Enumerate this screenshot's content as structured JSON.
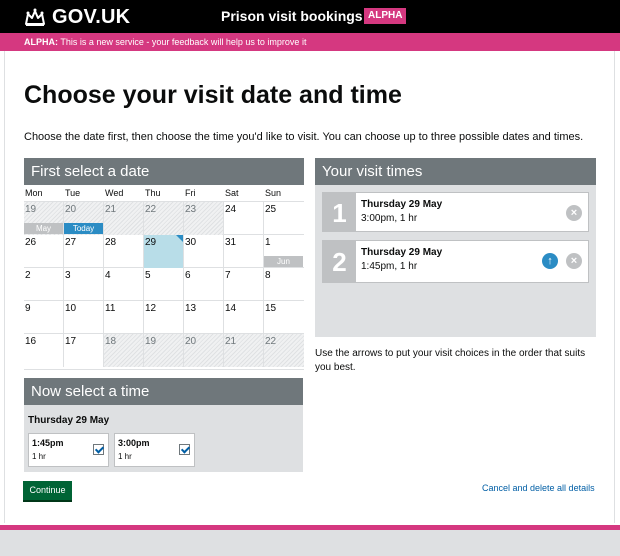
{
  "header": {
    "brand": "GOV.UK",
    "service_name": "Prison visit bookings",
    "phase_tag": "ALPHA"
  },
  "phase_banner": {
    "label": "ALPHA:",
    "text": "This is a new service - your feedback will help us to improve it"
  },
  "page": {
    "title": "Choose your visit date and time",
    "intro": "Choose the date first, then choose the time you'd like to visit. You can choose up to three possible dates and times."
  },
  "calendar": {
    "heading": "First select a date",
    "weekdays": [
      "Mon",
      "Tue",
      "Wed",
      "Thu",
      "Fri",
      "Sat",
      "Sun"
    ],
    "weeks": [
      [
        {
          "day": "19",
          "state": "past",
          "badge": "May",
          "badge_type": "month"
        },
        {
          "day": "20",
          "state": "past",
          "badge": "Today",
          "badge_type": "today"
        },
        {
          "day": "21",
          "state": "past"
        },
        {
          "day": "22",
          "state": "past"
        },
        {
          "day": "23",
          "state": "past"
        },
        {
          "day": "24",
          "state": "available"
        },
        {
          "day": "25",
          "state": "available"
        }
      ],
      [
        {
          "day": "26",
          "state": "available"
        },
        {
          "day": "27",
          "state": "available"
        },
        {
          "day": "28",
          "state": "available"
        },
        {
          "day": "29",
          "state": "selected"
        },
        {
          "day": "30",
          "state": "available"
        },
        {
          "day": "31",
          "state": "available"
        },
        {
          "day": "1",
          "state": "available",
          "badge": "Jun",
          "badge_type": "month"
        }
      ],
      [
        {
          "day": "2",
          "state": "available"
        },
        {
          "day": "3",
          "state": "available"
        },
        {
          "day": "4",
          "state": "available"
        },
        {
          "day": "5",
          "state": "available"
        },
        {
          "day": "6",
          "state": "available"
        },
        {
          "day": "7",
          "state": "available"
        },
        {
          "day": "8",
          "state": "available"
        }
      ],
      [
        {
          "day": "9",
          "state": "available"
        },
        {
          "day": "10",
          "state": "available"
        },
        {
          "day": "11",
          "state": "available"
        },
        {
          "day": "12",
          "state": "available"
        },
        {
          "day": "13",
          "state": "available"
        },
        {
          "day": "14",
          "state": "available"
        },
        {
          "day": "15",
          "state": "available"
        }
      ],
      [
        {
          "day": "16",
          "state": "available"
        },
        {
          "day": "17",
          "state": "available"
        },
        {
          "day": "18",
          "state": "out"
        },
        {
          "day": "19",
          "state": "out"
        },
        {
          "day": "20",
          "state": "out"
        },
        {
          "day": "21",
          "state": "out"
        },
        {
          "day": "22",
          "state": "out"
        }
      ]
    ]
  },
  "time_select": {
    "heading": "Now select a time",
    "date": "Thursday 29 May",
    "slots": [
      {
        "time": "1:45pm",
        "duration": "1 hr",
        "checked": true
      },
      {
        "time": "3:00pm",
        "duration": "1 hr",
        "checked": true
      }
    ]
  },
  "visit_times": {
    "heading": "Your visit times",
    "choices": [
      {
        "number": "1",
        "date": "Thursday 29 May",
        "time": "3:00pm, 1 hr",
        "remove": "×"
      },
      {
        "number": "2",
        "date": "Thursday 29 May",
        "time": "1:45pm, 1 hr",
        "move_up": "↑",
        "remove": "×"
      }
    ],
    "help": "Use the arrows to put your visit choices in the order that suits you best."
  },
  "actions": {
    "continue": "Continue",
    "cancel": "Cancel and delete all details"
  },
  "colors": {
    "header_bg": "#000000",
    "phase_pink": "#d53880",
    "panel_grey": "#dee0e2",
    "heading_grey": "#6f777b",
    "selected_blue": "#b8dde8",
    "today_blue": "#2b8cc4",
    "button_green": "#006435",
    "link_blue": "#005ea5"
  }
}
